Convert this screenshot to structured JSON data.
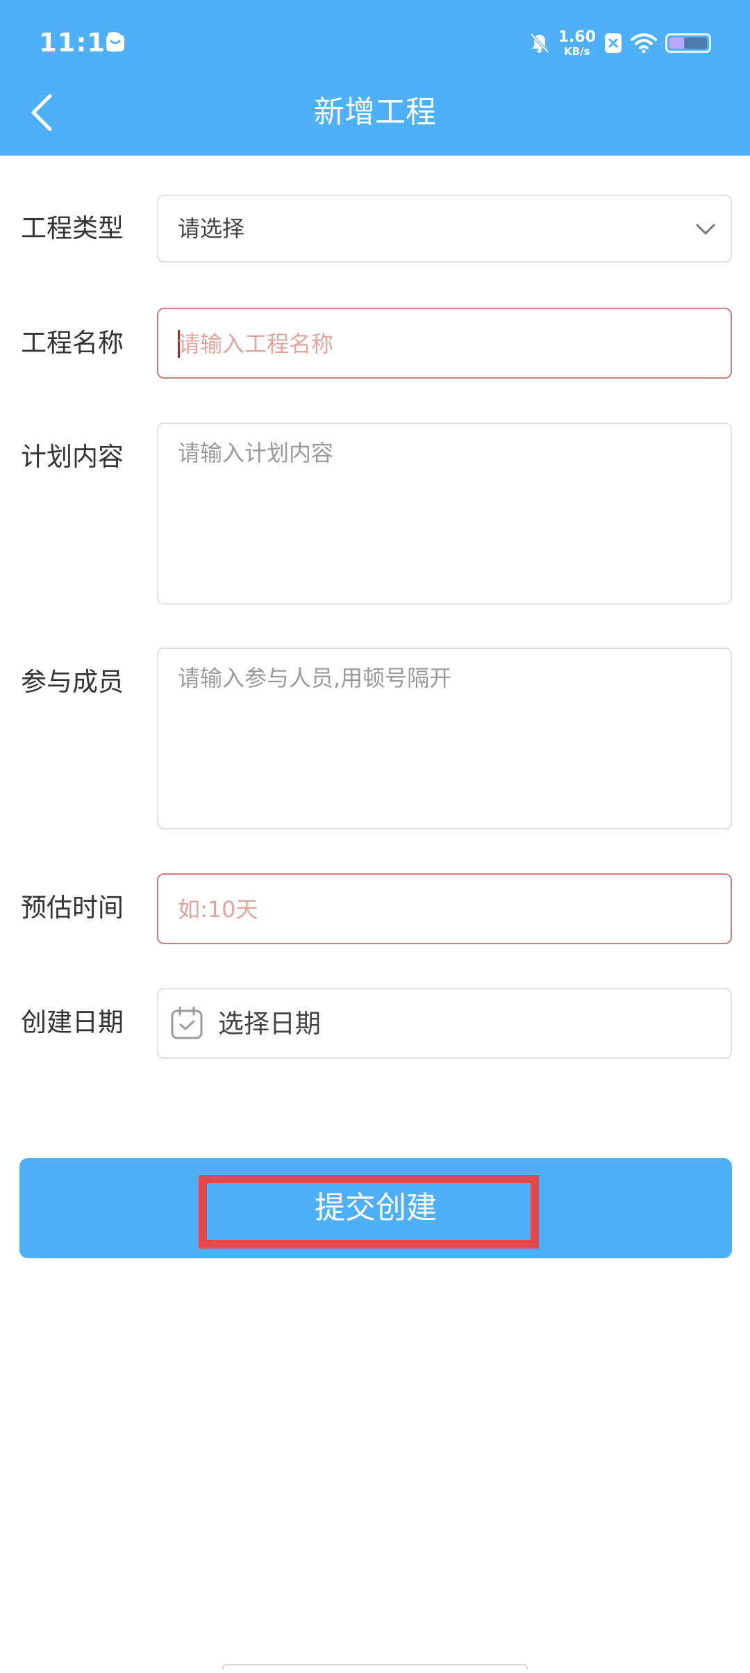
{
  "status_bar": {
    "time": "11:13",
    "net_speed_value": "1.60",
    "net_speed_unit": "KB/s",
    "icons": [
      "message-icon",
      "bell-off-icon",
      "close-box-icon",
      "wifi-icon",
      "battery-icon"
    ]
  },
  "header": {
    "title": "新增工程",
    "back_icon": "chevron-left-icon",
    "background": "#4db0f8"
  },
  "form": {
    "project_type": {
      "label": "工程类型",
      "value": "请选择"
    },
    "project_name": {
      "label": "工程名称",
      "placeholder": "请输入工程名称"
    },
    "plan_content": {
      "label": "计划内容",
      "placeholder": "请输入计划内容"
    },
    "members": {
      "label": "参与成员",
      "placeholder": "请输入参与人员,用顿号隔开"
    },
    "estimated_time": {
      "label": "预估时间",
      "placeholder": "如:10天"
    },
    "create_date": {
      "label": "创建日期",
      "value": "选择日期"
    }
  },
  "submit": {
    "label": "提交创建"
  },
  "colors": {
    "accent": "#4db0f8",
    "highlight": "#e5484d",
    "focus_border": "#c9817f"
  }
}
